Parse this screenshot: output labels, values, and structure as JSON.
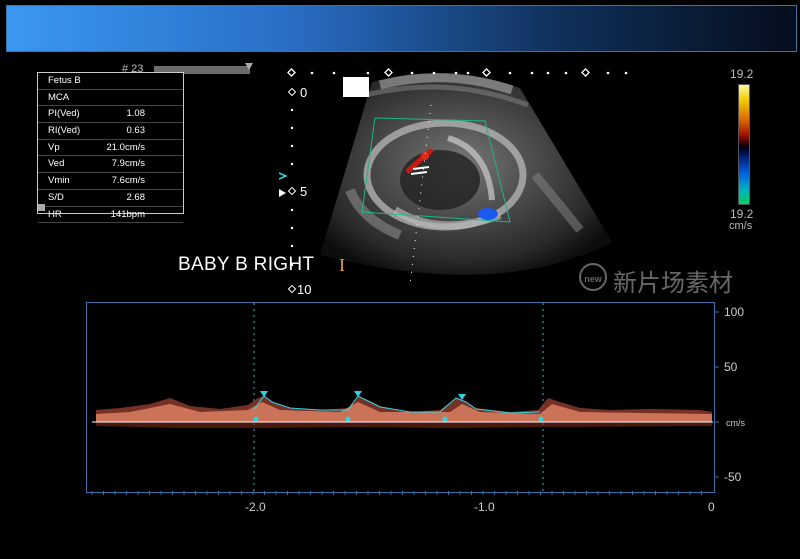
{
  "frame": {
    "number": "# 23"
  },
  "measurements": {
    "title": "Fetus B",
    "vessel": "MCA",
    "rows": [
      {
        "label": "PI(Ved)",
        "value": "1.08"
      },
      {
        "label": "RI(Ved)",
        "value": "0.63"
      },
      {
        "label": "Vp",
        "value": "21.0cm/s"
      },
      {
        "label": "Ved",
        "value": "7.9cm/s"
      },
      {
        "label": "Vmin",
        "value": "7.6cm/s"
      },
      {
        "label": "S/D",
        "value": "2.68"
      },
      {
        "label": "HR",
        "value": "141bpm"
      }
    ]
  },
  "depth_scale": {
    "labels": [
      "0",
      "5",
      "10"
    ]
  },
  "annotation": {
    "text": "BABY B RIGHT",
    "marker": "I"
  },
  "color_scale": {
    "max": "19.2",
    "min": "19.2",
    "unit": "cm/s"
  },
  "watermark": {
    "badge": "new",
    "text": "新片场素材"
  },
  "spectral": {
    "y_labels": [
      "100",
      "50",
      "cm/s",
      "-50"
    ],
    "x_labels": [
      "-2.0",
      "-1.0",
      "0"
    ]
  }
}
